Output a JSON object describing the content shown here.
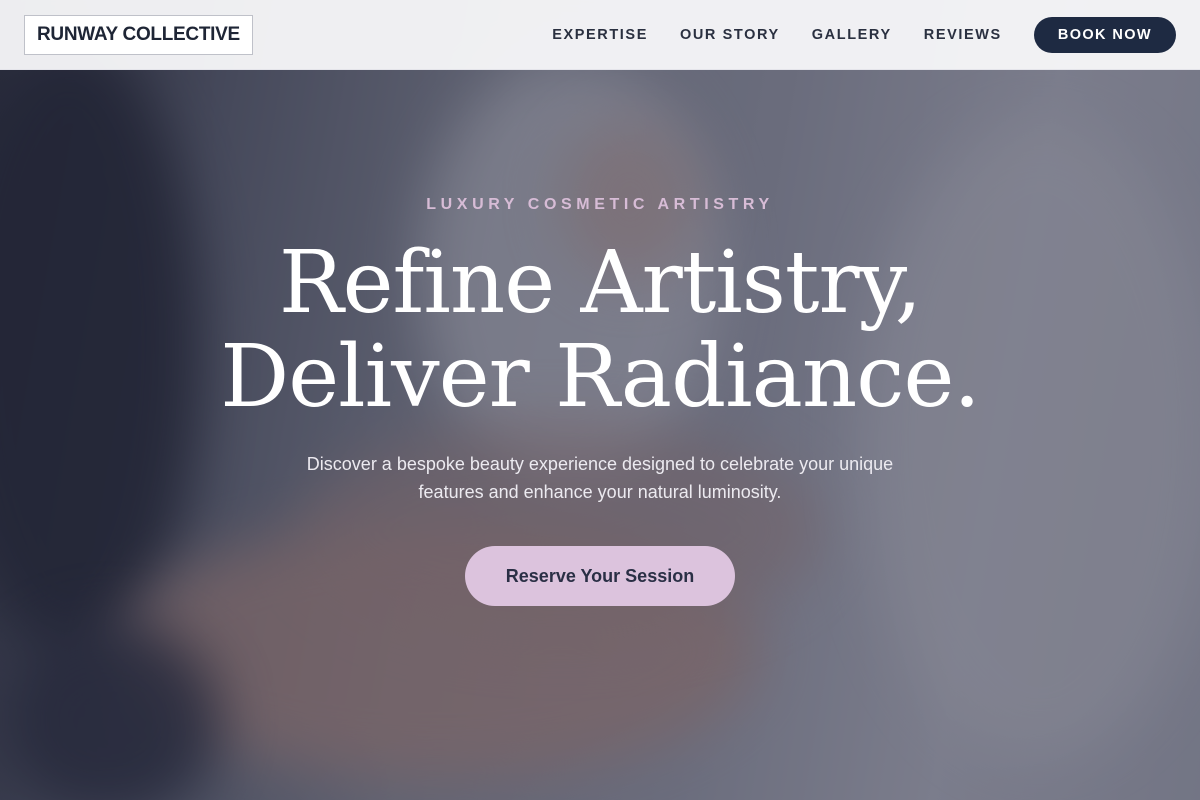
{
  "brand": {
    "logo_text": "RUNWAY COLLECTIVE"
  },
  "nav": {
    "links": [
      "EXPERTISE",
      "OUR STORY",
      "GALLERY",
      "REVIEWS"
    ],
    "book_label": "BOOK NOW"
  },
  "hero": {
    "eyebrow": "LUXURY COSMETIC ARTISTRY",
    "headline_line1": "Refine Artistry,",
    "headline_line2": "Deliver Radiance.",
    "subtext": "Discover a bespoke beauty experience designed to celebrate your unique features and enhance your natural luminosity.",
    "cta_label": "Reserve Your Session"
  },
  "colors": {
    "accent": "#dcc3dd",
    "navy": "#1e2a42",
    "eyebrow": "#d7bcd6"
  }
}
